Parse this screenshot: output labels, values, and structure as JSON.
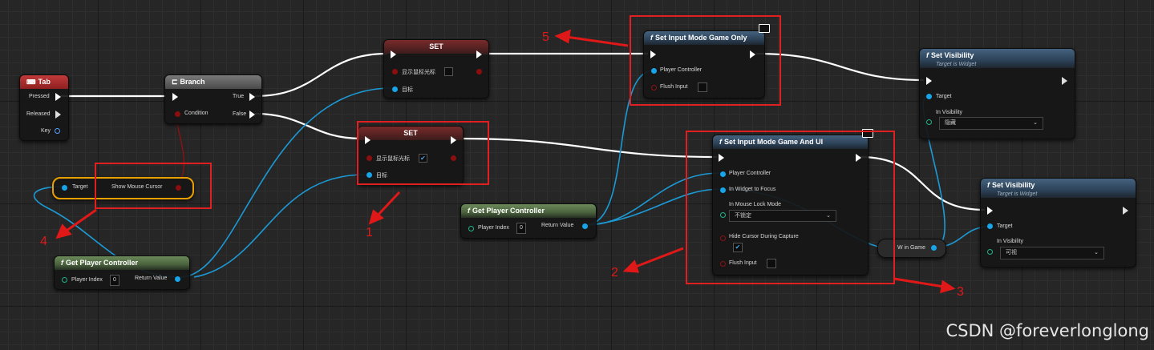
{
  "nodes": {
    "tab": {
      "title": "Tab",
      "pins": {
        "pressed": "Pressed",
        "released": "Released",
        "key": "Key"
      }
    },
    "branch": {
      "title": "Branch",
      "pins": {
        "condition": "Condition",
        "true": "True",
        "false": "False"
      }
    },
    "set_top": {
      "title": "SET",
      "pins": {
        "var": "显示鼠标光标",
        "target": "目标"
      }
    },
    "set_bottom": {
      "title": "SET",
      "pins": {
        "var": "显示鼠标光标",
        "target": "目标"
      }
    },
    "set_input_game_only": {
      "icon": "f",
      "title": "Set Input Mode Game Only",
      "pins": {
        "player_controller": "Player Controller",
        "flush_input": "Flush Input"
      }
    },
    "set_input_game_ui": {
      "icon": "f",
      "title": "Set Input Mode Game And UI",
      "pins": {
        "player_controller": "Player Controller",
        "widget_focus": "In Widget to Focus",
        "mouse_lock": "In Mouse Lock Mode",
        "mouse_lock_value": "不锁定",
        "hide_cursor": "Hide Cursor During Capture",
        "flush_input": "Flush Input"
      }
    },
    "set_visibility_top": {
      "icon": "f",
      "title": "Set Visibility",
      "subtitle": "Target is Widget",
      "pins": {
        "target": "Target",
        "in_visibility": "In Visibility",
        "visibility_value": "隐藏"
      }
    },
    "set_visibility_bottom": {
      "icon": "f",
      "title": "Set Visibility",
      "subtitle": "Target is Widget",
      "pins": {
        "target": "Target",
        "in_visibility": "In Visibility",
        "visibility_value": "可视"
      }
    },
    "get_pc_left": {
      "icon": "f",
      "title": "Get Player Controller",
      "pins": {
        "player_index": "Player Index",
        "player_index_value": "0",
        "return_value": "Return Value"
      }
    },
    "get_pc_mid": {
      "icon": "f",
      "title": "Get Player Controller",
      "pins": {
        "player_index": "Player Index",
        "player_index_value": "0",
        "return_value": "Return Value"
      }
    },
    "show_mouse_cursor": {
      "pins": {
        "target": "Target",
        "output": "Show Mouse Cursor"
      }
    },
    "w_in_game": {
      "label": "W in Game"
    }
  },
  "annotations": {
    "a1": "1",
    "a2": "2",
    "a3": "3",
    "a4": "4",
    "a5": "5"
  },
  "watermark": "CSDN @foreverlonglong",
  "colors": {
    "exec_wire": "#ffffff",
    "object_wire": "#1c9ad6",
    "annotation": "#e01818",
    "bool_pin": "#8c0e0e"
  }
}
